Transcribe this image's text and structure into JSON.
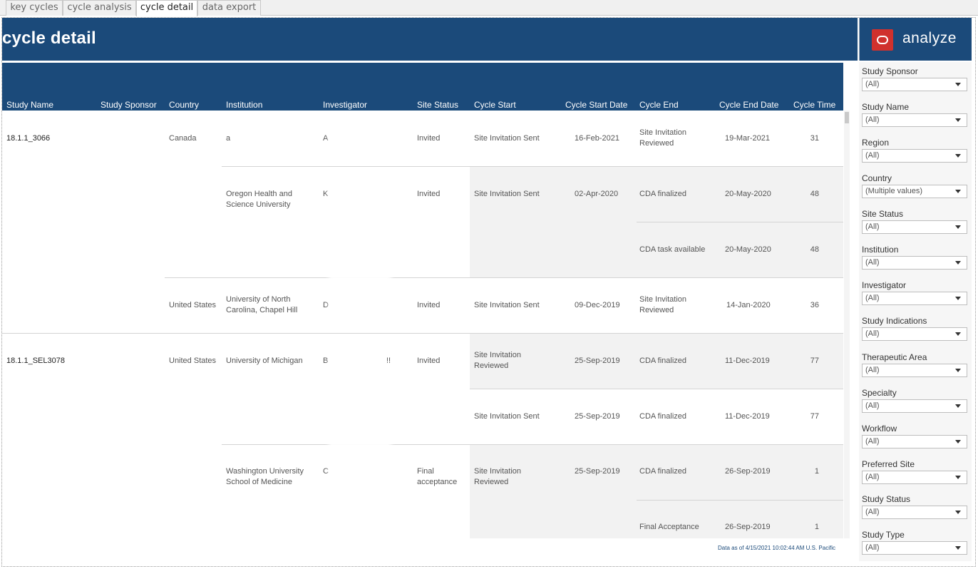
{
  "tabs": [
    "key cycles",
    "cycle analysis",
    "cycle detail",
    "data export"
  ],
  "header": {
    "title": "cycle detail",
    "brand": "analyze"
  },
  "columns": [
    "Study Name",
    "Study Sponsor",
    "Country",
    "Institution",
    "Investigator",
    "Site Status",
    "Cycle Start",
    "Cycle Start Date",
    "Cycle End",
    "Cycle End Date",
    "Cycle Time"
  ],
  "rows": [
    {
      "study_name": "18.1.1_3066",
      "country": "Canada",
      "institution": "a",
      "investigator": "A",
      "site_status": "Invited",
      "cycle_start": "Site Invitation Sent",
      "cycle_start_date": "16-Feb-2021",
      "cycle_end": "Site Invitation Reviewed",
      "cycle_end_date": "19-Mar-2021",
      "cycle_time": "31"
    },
    {
      "institution": "Oregon Health and Science University",
      "investigator": "K",
      "site_status": "Invited",
      "cycle_start": "Site Invitation Sent",
      "cycle_start_date": "02-Apr-2020",
      "cycle_end": "CDA finalized",
      "cycle_end_date": "20-May-2020",
      "cycle_time": "48"
    },
    {
      "cycle_end": "CDA task available",
      "cycle_end_date": "20-May-2020",
      "cycle_time": "48"
    },
    {
      "country": "United States",
      "institution": "University of North Carolina, Chapel Hill",
      "investigator": "D",
      "site_status": "Invited",
      "cycle_start": "Site Invitation Sent",
      "cycle_start_date": "09-Dec-2019",
      "cycle_end": "Site Invitation Reviewed",
      "cycle_end_date": "14-Jan-2020",
      "cycle_time": "36"
    },
    {
      "study_name": "18.1.1_SEL3078",
      "country": "United States",
      "institution": "University of Michigan",
      "investigator": "B",
      "investigator_tail": "!!",
      "site_status": "Invited",
      "cycle_start": "Site Invitation Reviewed",
      "cycle_start_date": "25-Sep-2019",
      "cycle_end": "CDA finalized",
      "cycle_end_date": "11-Dec-2019",
      "cycle_time": "77"
    },
    {
      "cycle_start": "Site Invitation Sent",
      "cycle_start_date": "25-Sep-2019",
      "cycle_end": "CDA finalized",
      "cycle_end_date": "11-Dec-2019",
      "cycle_time": "77"
    },
    {
      "institution": "Washington University School of Medicine",
      "investigator": "C",
      "site_status": "Final acceptance",
      "cycle_start": "Site Invitation Reviewed",
      "cycle_start_date": "25-Sep-2019",
      "cycle_end": "CDA finalized",
      "cycle_end_date": "26-Sep-2019",
      "cycle_time": "1"
    },
    {
      "cycle_end": "Final Acceptance",
      "cycle_end_date": "26-Sep-2019",
      "cycle_time": "1"
    }
  ],
  "footer_note": "Data as of 4/15/2021 10:02:44 AM U.S. Pacific",
  "filters": [
    {
      "label": "Study Sponsor",
      "value": "(All)"
    },
    {
      "label": "Study Name",
      "value": "(All)"
    },
    {
      "label": "Region",
      "value": "(All)"
    },
    {
      "label": "Country",
      "value": "(Multiple values)"
    },
    {
      "label": "Site Status",
      "value": "(All)"
    },
    {
      "label": "Institution",
      "value": "(All)"
    },
    {
      "label": "Investigator",
      "value": "(All)"
    },
    {
      "label": "Study Indications",
      "value": "(All)"
    },
    {
      "label": "Therapeutic Area",
      "value": "(All)"
    },
    {
      "label": "Specialty",
      "value": "(All)"
    },
    {
      "label": "Workflow",
      "value": "(All)"
    },
    {
      "label": "Preferred Site",
      "value": "(All)"
    },
    {
      "label": "Study Status",
      "value": "(All)"
    },
    {
      "label": "Study Type",
      "value": "(All)"
    }
  ]
}
